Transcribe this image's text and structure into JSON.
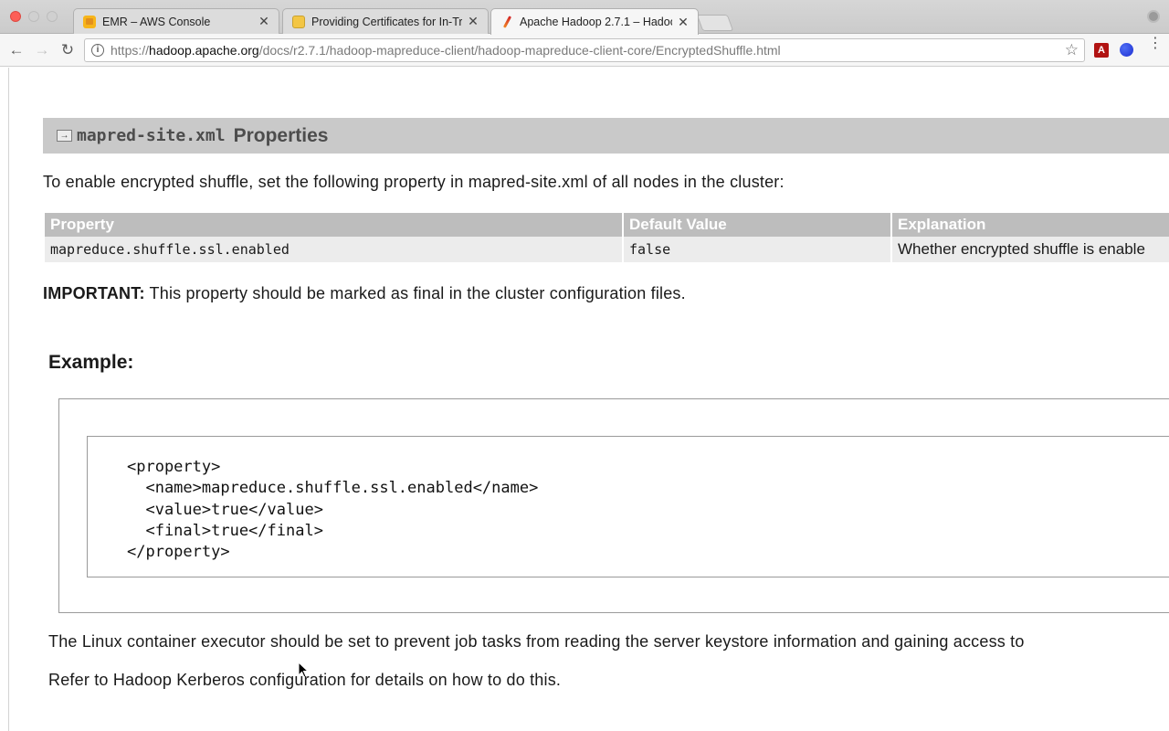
{
  "browser": {
    "tabs": [
      {
        "title": "EMR – AWS Console",
        "icon": "aws-icon",
        "active": false
      },
      {
        "title": "Providing Certificates for In-Tr",
        "icon": "document-icon",
        "active": false
      },
      {
        "title": "Apache Hadoop 2.7.1 – Hadoo",
        "icon": "hadoop-feather-icon",
        "active": true
      }
    ],
    "close_glyph": "✕",
    "url": {
      "scheme": "https://",
      "host": "hadoop.apache.org",
      "path": "/docs/r2.7.1/hadoop-mapreduce-client/hadoop-mapreduce-client-core/EncryptedShuffle.html"
    }
  },
  "page": {
    "section": {
      "code_title": "mapred-site.xml",
      "title": "Properties"
    },
    "intro": "To enable encrypted shuffle, set the following property in mapred-site.xml of all nodes in the cluster:",
    "table": {
      "headers": [
        "Property",
        "Default Value",
        "Explanation"
      ],
      "rows": [
        [
          "mapreduce.shuffle.ssl.enabled",
          "false",
          "Whether encrypted shuffle is enable"
        ]
      ]
    },
    "important": {
      "label": "IMPORTANT:",
      "text": " This property should be marked as final in the cluster configuration files."
    },
    "example": {
      "title": "Example:",
      "code_lines": [
        "<property>",
        "  <name>mapreduce.shuffle.ssl.enabled</name>",
        "  <value>true</value>",
        "  <final>true</final>",
        "</property>"
      ]
    },
    "linux_note": "The Linux container executor should be set to prevent job tasks from reading the server keystore information and gaining access to",
    "refer_note": "Refer to Hadoop Kerberos configuration for details on how to do this."
  }
}
